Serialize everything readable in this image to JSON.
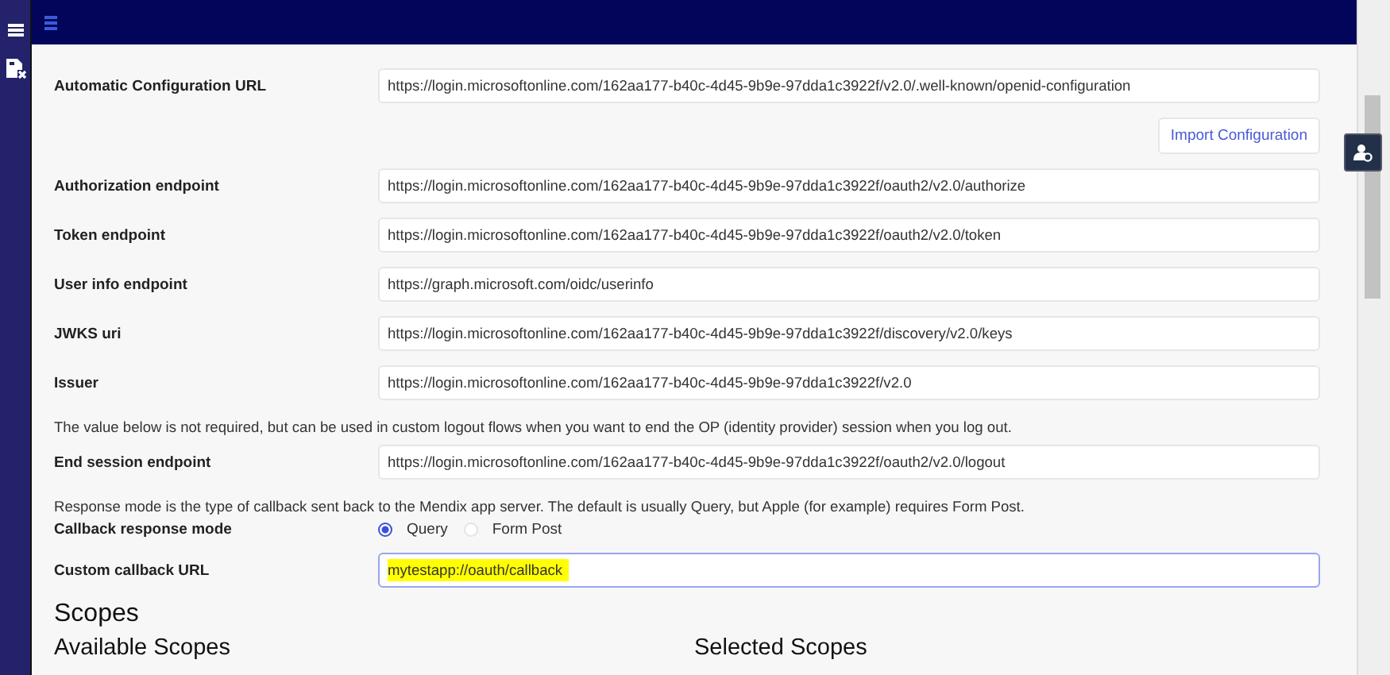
{
  "form": [
    {
      "kind": "field",
      "label": "Automatic Configuration URL",
      "value": "https://login.microsoftonline.com/162aa177-b40c-4d45-9b9e-97dda1c3922f/v2.0/.well-known/openid-configuration",
      "highlighted": false,
      "focused": false
    },
    {
      "kind": "button",
      "label": "Import Configuration"
    },
    {
      "kind": "field",
      "label": "Authorization endpoint",
      "value": "https://login.microsoftonline.com/162aa177-b40c-4d45-9b9e-97dda1c3922f/oauth2/v2.0/authorize",
      "highlighted": false,
      "focused": false
    },
    {
      "kind": "field",
      "label": "Token endpoint",
      "value": "https://login.microsoftonline.com/162aa177-b40c-4d45-9b9e-97dda1c3922f/oauth2/v2.0/token",
      "highlighted": false,
      "focused": false
    },
    {
      "kind": "field",
      "label": "User info endpoint",
      "value": "https://graph.microsoft.com/oidc/userinfo",
      "highlighted": false,
      "focused": false
    },
    {
      "kind": "field",
      "label": "JWKS uri",
      "value": "https://login.microsoftonline.com/162aa177-b40c-4d45-9b9e-97dda1c3922f/discovery/v2.0/keys",
      "highlighted": false,
      "focused": false
    },
    {
      "kind": "field",
      "label": "Issuer",
      "value": "https://login.microsoftonline.com/162aa177-b40c-4d45-9b9e-97dda1c3922f/v2.0",
      "highlighted": false,
      "focused": false
    },
    {
      "kind": "note",
      "text": "The value below is not required, but can be used in custom logout flows when you want to end the OP (identity provider) session when you log out."
    },
    {
      "kind": "field",
      "label": "End session endpoint",
      "value": "https://login.microsoftonline.com/162aa177-b40c-4d45-9b9e-97dda1c3922f/oauth2/v2.0/logout",
      "highlighted": false,
      "focused": false
    },
    {
      "kind": "note",
      "text": "Response mode is the type of callback sent back to the Mendix app server. The default is usually Query, but Apple (for example) requires Form Post."
    },
    {
      "kind": "radio",
      "label": "Callback response mode",
      "options": [
        {
          "label": "Query",
          "selected": true
        },
        {
          "label": "Form Post",
          "selected": false
        }
      ]
    },
    {
      "kind": "field",
      "label": "Custom callback URL",
      "value": "mytestapp://oauth/callback",
      "highlighted": true,
      "focused": true
    }
  ],
  "scopes": {
    "title": "Scopes",
    "available_title": "Available Scopes",
    "selected_title": "Selected Scopes"
  }
}
